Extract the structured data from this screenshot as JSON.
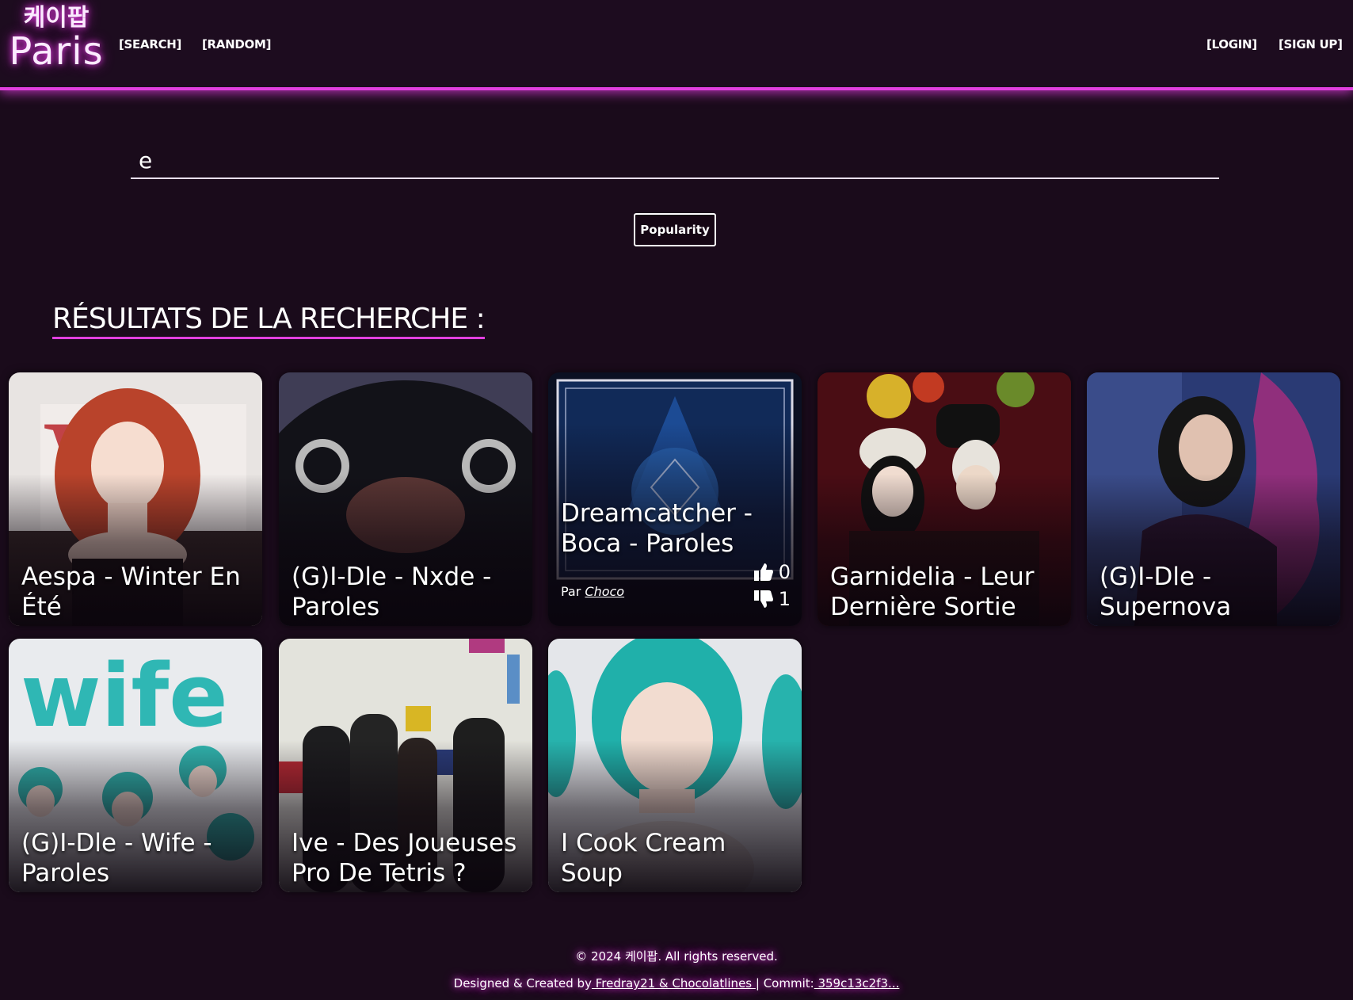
{
  "header": {
    "logo_korean": "케이팝",
    "logo_city": "Paris",
    "nav_left": [
      "[SEARCH]",
      "[RANDOM]"
    ],
    "nav_right": [
      "[LOGIN]",
      "[SIGN UP]"
    ]
  },
  "search": {
    "value": "e",
    "sort_label": "Popularity"
  },
  "results": {
    "title": "RÉSULTATS DE LA RECHERCHE :",
    "cards": [
      {
        "title": "Aespa - Winter En Été"
      },
      {
        "title": "(G)I-Dle - Nxde - Paroles"
      },
      {
        "title": "Dreamcatcher - Boca - Paroles",
        "author_prefix": "Par",
        "author": "Choco",
        "likes": "0",
        "dislikes": "1"
      },
      {
        "title": "Garnidelia - Leur Dernière Sortie"
      },
      {
        "title": "(G)I-Dle - Supernova"
      },
      {
        "title": "(G)I-Dle - Wife - Paroles"
      },
      {
        "title": "Ive - Des Joueuses Pro De Tetris ?"
      },
      {
        "title": "I Cook Cream Soup"
      }
    ]
  },
  "footer": {
    "copyright": "© 2024 케이팝. All rights reserved.",
    "credits_prefix": "Designed & Created by",
    "credits_authors": " Fredray21 & Chocolatlines ",
    "commit_prefix": "| Commit:",
    "commit_hash": " 359c13c2f3..."
  },
  "colors": {
    "accent": "#e23fe0",
    "background": "#1a0b1b"
  }
}
